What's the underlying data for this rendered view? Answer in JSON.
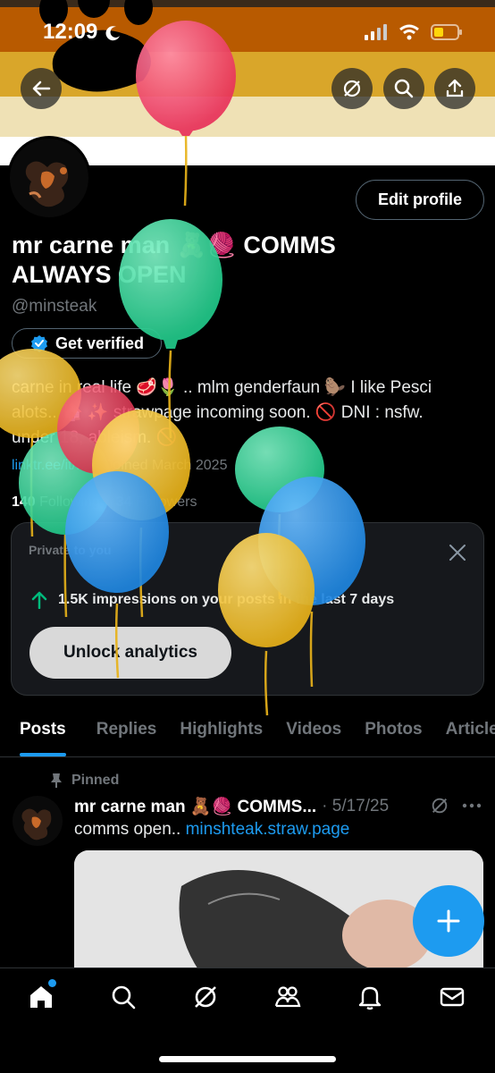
{
  "status": {
    "time": "12:09"
  },
  "banner": {
    "colors": [
      "#3a2a1a",
      "#b85a00",
      "#d99a1e",
      "#e6c85a",
      "#f1e6c4",
      "#ffffff"
    ]
  },
  "profile": {
    "edit_label": "Edit profile",
    "name": "mr carne man 🧸🧶 COMMS ALWAYS OPEN",
    "handle": "@minsteak",
    "verify_label": "Get verified",
    "bio_line1": "carne in real life 🥩🌷 .. mlm genderfaun 🦫 I like Pesci",
    "bio_line2": "alots.. 🏠 ✨ strawpage incoming soon. 🚫 DNI : nsfw.",
    "bio_line3": "under 18, ableism. 🚫",
    "link": "linktr.ee/it/...",
    "joined": "Joined March 2025",
    "following_count": "140",
    "following_label": "Following",
    "followers_count": "34",
    "followers_label": "Followers"
  },
  "analytics": {
    "private_label": "Private to you",
    "impressions": "1.5K impressions on your posts in the last 7 days",
    "unlock_label": "Unlock analytics"
  },
  "tabs": [
    "Posts",
    "Replies",
    "Highlights",
    "Videos",
    "Photos",
    "Articles"
  ],
  "post": {
    "pinned_label": "Pinned",
    "name": "mr carne man 🧸🧶 COMMS...",
    "date": "· 5/17/25",
    "text": "comms open..",
    "link": "minshteak.straw.page"
  },
  "nav": [
    "home-icon",
    "search-icon",
    "grok-icon",
    "communities-icon",
    "notifications-icon",
    "messages-icon"
  ],
  "accent": "#1d9bf0"
}
